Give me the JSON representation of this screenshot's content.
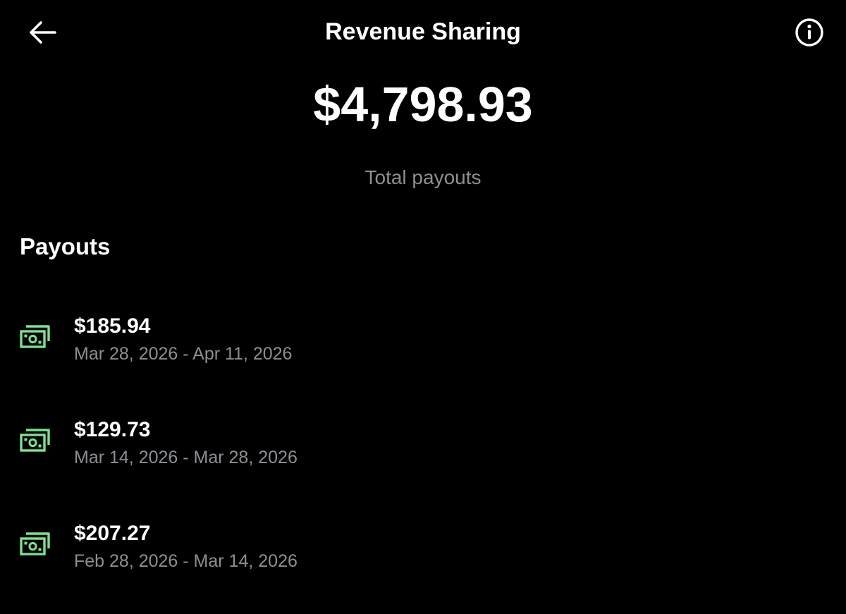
{
  "header": {
    "title": "Revenue Sharing",
    "back_icon": "arrow-left-icon",
    "info_icon": "info-circle-icon"
  },
  "summary": {
    "total_amount": "$4,798.93",
    "total_label": "Total payouts"
  },
  "payouts": {
    "section_title": "Payouts",
    "icon": "money-bill-icon",
    "icon_color": "#7ee092",
    "items": [
      {
        "amount": "$185.94",
        "range": "Mar 28, 2026 - Apr 11, 2026"
      },
      {
        "amount": "$129.73",
        "range": "Mar 14, 2026 - Mar 28, 2026"
      },
      {
        "amount": "$207.27",
        "range": "Feb 28, 2026 - Mar 14, 2026"
      }
    ]
  },
  "colors": {
    "background": "#000000",
    "text_primary": "#ffffff",
    "text_secondary": "#8b8f94",
    "accent_green": "#7ee092"
  }
}
